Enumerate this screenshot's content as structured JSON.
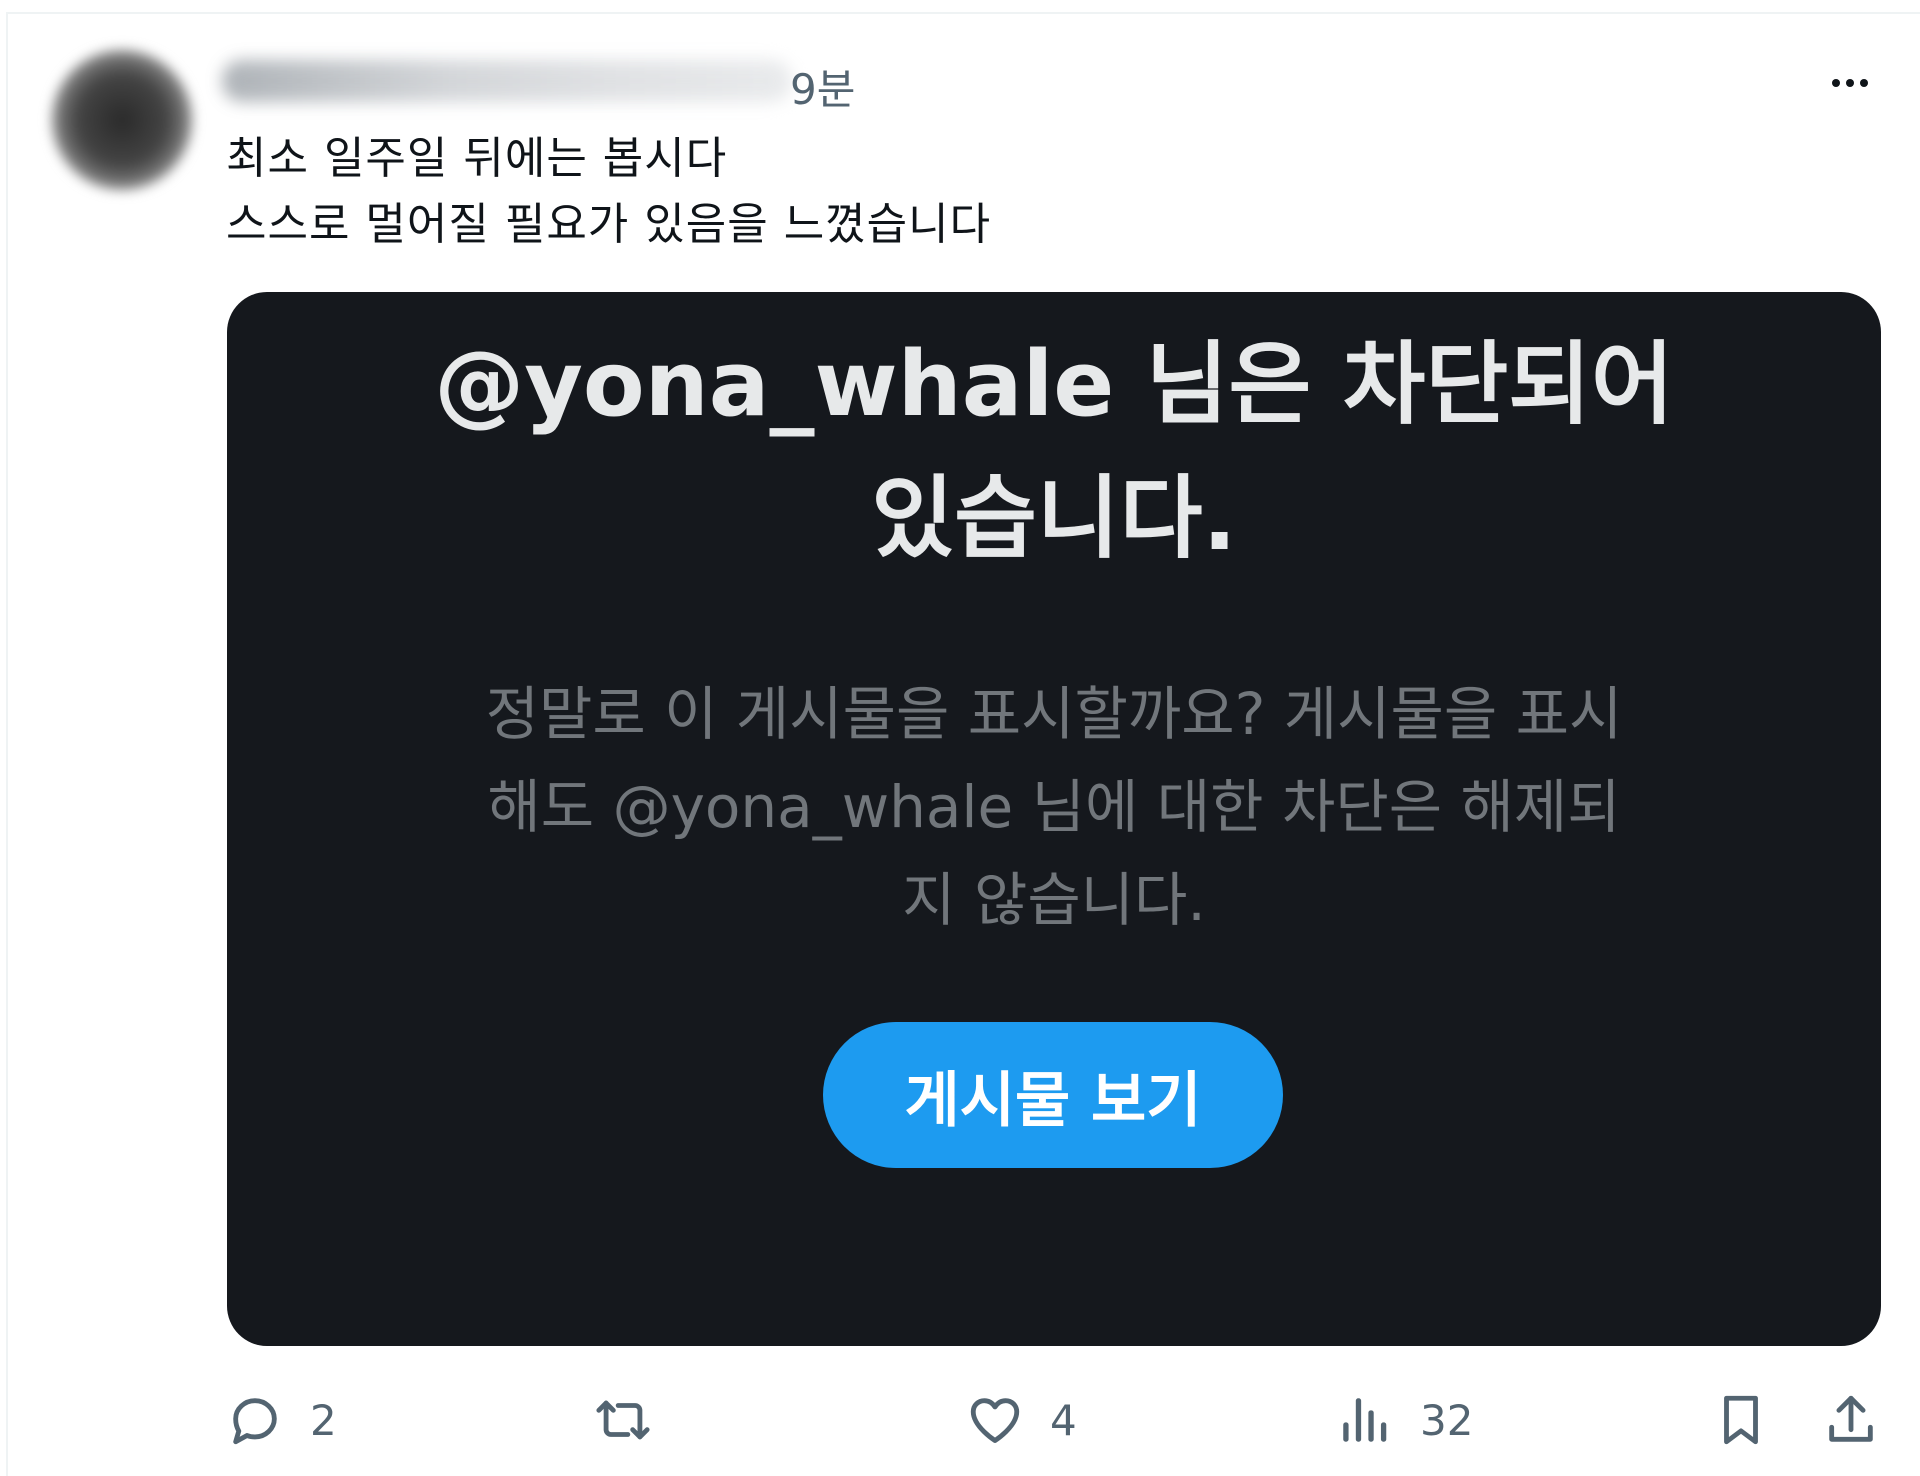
{
  "post": {
    "time": "9분",
    "text": "최소 일주일 뒤에는 봅시다\n스스로 멀어질 필요가 있음을 느꼈습니다"
  },
  "blocked_card": {
    "title": "@yona_whale 님은 차단되어 있습니다.",
    "description": "정말로 이 게시물을 표시할까요? 게시물을 표시해도 @yona_whale 님에 대한 차단은 해제되지 않습니다.",
    "button_label": "게시물 보기",
    "button_color": "#1d9bf0",
    "background": "#15181d"
  },
  "actions": {
    "reply_count": "2",
    "retweet_count": "",
    "like_count": "4",
    "views_count": "32"
  },
  "icons": [
    "more-icon",
    "reply-icon",
    "retweet-icon",
    "like-icon",
    "views-icon",
    "bookmark-icon",
    "share-icon"
  ]
}
